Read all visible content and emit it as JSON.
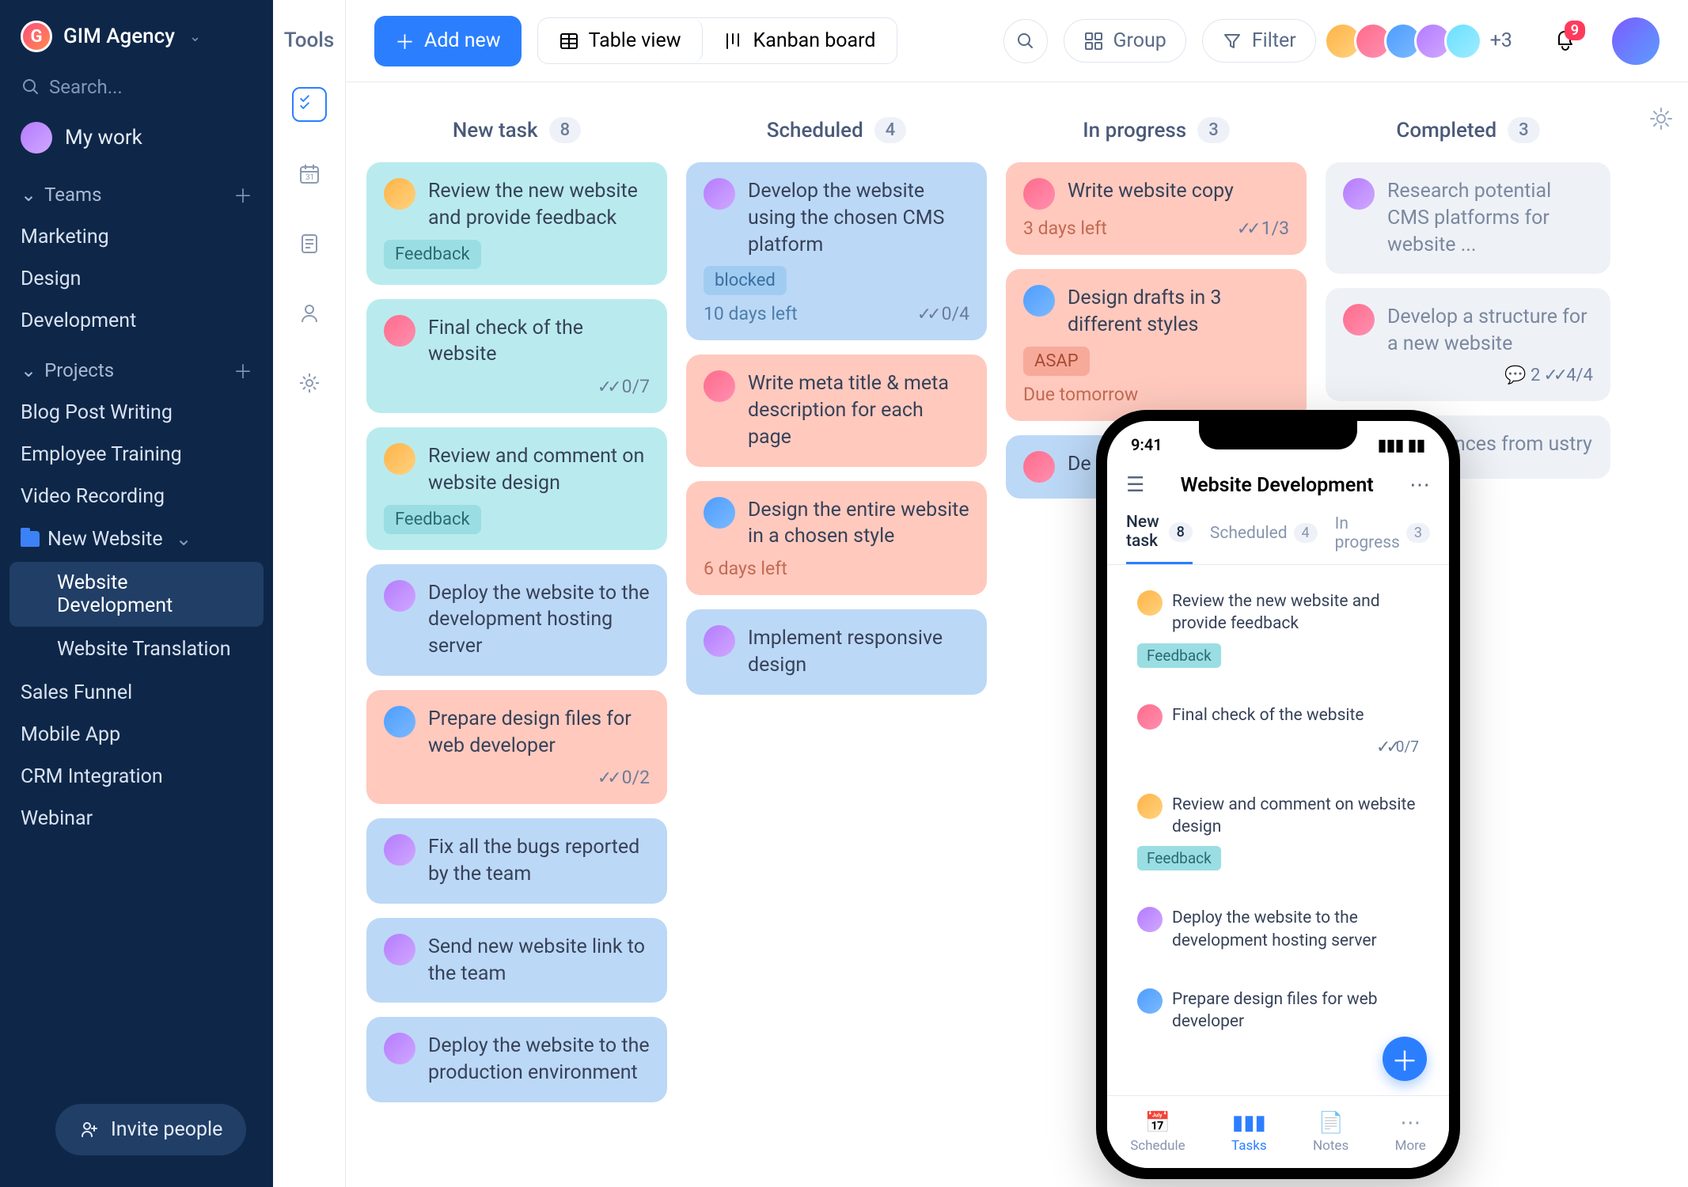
{
  "workspace": {
    "name": "GIM Agency"
  },
  "search": {
    "placeholder": "Search..."
  },
  "mywork": {
    "label": "My work"
  },
  "sections": {
    "teams": "Teams",
    "projects": "Projects"
  },
  "teams": [
    "Marketing",
    "Design",
    "Development"
  ],
  "projects": {
    "simple": [
      "Blog Post Writing",
      "Employee Training",
      "Video Recording"
    ],
    "folder": {
      "name": "New Website",
      "children": [
        "Website Development",
        "Website Translation"
      ],
      "activeIndex": 0
    },
    "rest": [
      "Sales Funnel",
      "Mobile App",
      "CRM Integration",
      "Webinar"
    ]
  },
  "invite": {
    "label": "Invite people"
  },
  "rail": {
    "label": "Tools"
  },
  "topbar": {
    "add": "Add new",
    "table": "Table view",
    "kanban": "Kanban board",
    "group": "Group",
    "filter": "Filter",
    "moreCount": "+3",
    "badge": "9"
  },
  "columns": [
    {
      "name": "New task",
      "count": "8"
    },
    {
      "name": "Scheduled",
      "count": "4"
    },
    {
      "name": "In progress",
      "count": "3"
    },
    {
      "name": "Completed",
      "count": "3"
    }
  ],
  "newtask": [
    {
      "title": "Review the new website and provide feedback",
      "tag": "Feedback",
      "color": "teal",
      "av": "a1"
    },
    {
      "title": "Final check of the website",
      "check": "0/7",
      "color": "teal",
      "av": "a2"
    },
    {
      "title": "Review and comment on website design",
      "tag": "Feedback",
      "color": "teal",
      "av": "a1"
    },
    {
      "title": "Deploy the website to the development hosting server",
      "color": "blue",
      "av": "a4"
    },
    {
      "title": "Prepare design files for web developer",
      "check": "0/2",
      "color": "peach",
      "av": "a3"
    },
    {
      "title": "Fix all the bugs reported by the team",
      "color": "blue",
      "av": "a4"
    },
    {
      "title": "Send new website link to the team",
      "color": "blue",
      "av": "a4"
    },
    {
      "title": "Deploy the website to the production environment",
      "color": "blue",
      "av": "a4"
    }
  ],
  "scheduled": [
    {
      "title": "Develop the website using the chosen CMS platform",
      "tag": "blocked",
      "due": "10 days left",
      "check": "0/4",
      "color": "blue",
      "av": "a4"
    },
    {
      "title": "Write meta title & meta description for each page",
      "color": "peach",
      "av": "a2"
    },
    {
      "title": "Design the entire website in a chosen style",
      "due": "6 days left",
      "color": "peach",
      "av": "a3"
    },
    {
      "title": "Implement responsive design",
      "color": "blue",
      "av": "a4"
    }
  ],
  "inprogress": [
    {
      "title": "Write website copy",
      "due": "3 days left",
      "check": "1/3",
      "color": "peach",
      "av": "a2"
    },
    {
      "title": "Design drafts in 3 different styles",
      "tag": "ASAP",
      "due": "Due tomorrow",
      "color": "peach",
      "av": "a3"
    },
    {
      "title": "De",
      "color": "blue",
      "av": "a2"
    }
  ],
  "completed": [
    {
      "title": "Research potential CMS platforms for website ...",
      "color": "grey",
      "av": "a4"
    },
    {
      "title": "Develop a structure for a new website",
      "c1": "2",
      "c2": "4/4",
      "color": "grey",
      "av": "a2"
    },
    {
      "title": "0 references from ustry",
      "color": "grey",
      "av": ""
    }
  ],
  "phone": {
    "time": "9:41",
    "title": "Website Development",
    "tabs": [
      {
        "l": "New task",
        "c": "8"
      },
      {
        "l": "Scheduled",
        "c": "4"
      },
      {
        "l": "In progress",
        "c": "3"
      }
    ],
    "cards": [
      {
        "title": "Review the new website and provide feedback",
        "tag": "Feedback",
        "color": "teal",
        "av": "a1"
      },
      {
        "title": "Final check of the website",
        "check": "0/7",
        "color": "teal",
        "av": "a2"
      },
      {
        "title": "Review and comment on website design",
        "tag": "Feedback",
        "color": "teal",
        "av": "a1"
      },
      {
        "title": "Deploy the website to the development hosting server",
        "color": "blue",
        "av": "a4"
      },
      {
        "title": "Prepare design files for web developer",
        "color": "peach",
        "av": "a3"
      }
    ],
    "nav": [
      "Schedule",
      "Tasks",
      "Notes",
      "More"
    ]
  }
}
